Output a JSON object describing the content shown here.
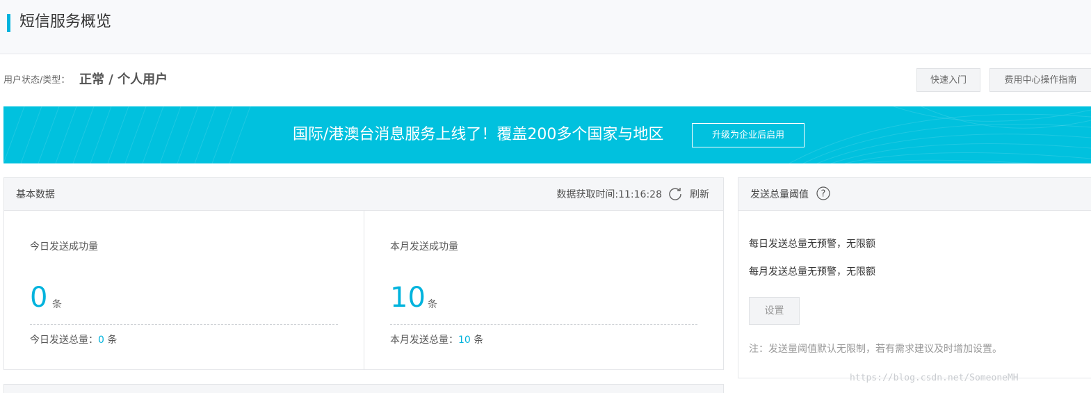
{
  "header": {
    "title": "短信服务概览"
  },
  "user_status": {
    "label": "用户状态/类型：",
    "value": "正常 / 个人用户"
  },
  "top_buttons": {
    "quick_start": "快速入门",
    "billing_guide": "费用中心操作指南"
  },
  "banner": {
    "text": "国际/港澳台消息服务上线了！覆盖200多个国家与地区",
    "button": "升级为企业后启用"
  },
  "basic_data": {
    "title": "基本数据",
    "fetch_time": "数据获取时间:11:16:28",
    "refresh": "刷新",
    "today": {
      "label": "今日发送成功量",
      "value": "0",
      "unit": "条",
      "total_label": "今日发送总量：",
      "total_value": "0",
      "total_unit": "条"
    },
    "month": {
      "label": "本月发送成功量",
      "value": "10",
      "unit": "条",
      "total_label": "本月发送总量：",
      "total_value": "10",
      "total_unit": "条"
    }
  },
  "threshold": {
    "title": "发送总量阈值",
    "daily": "每日发送总量无预警，无限额",
    "monthly": "每月发送总量无预警，无限额",
    "set_button": "设置",
    "note": "注：发送量阈值默认无限制，若有需求建议及时增加设置。"
  },
  "watermark": "https://blog.csdn.net/SomeoneMH",
  "colors": {
    "accent": "#00b3dd",
    "banner": "#01c1de"
  }
}
